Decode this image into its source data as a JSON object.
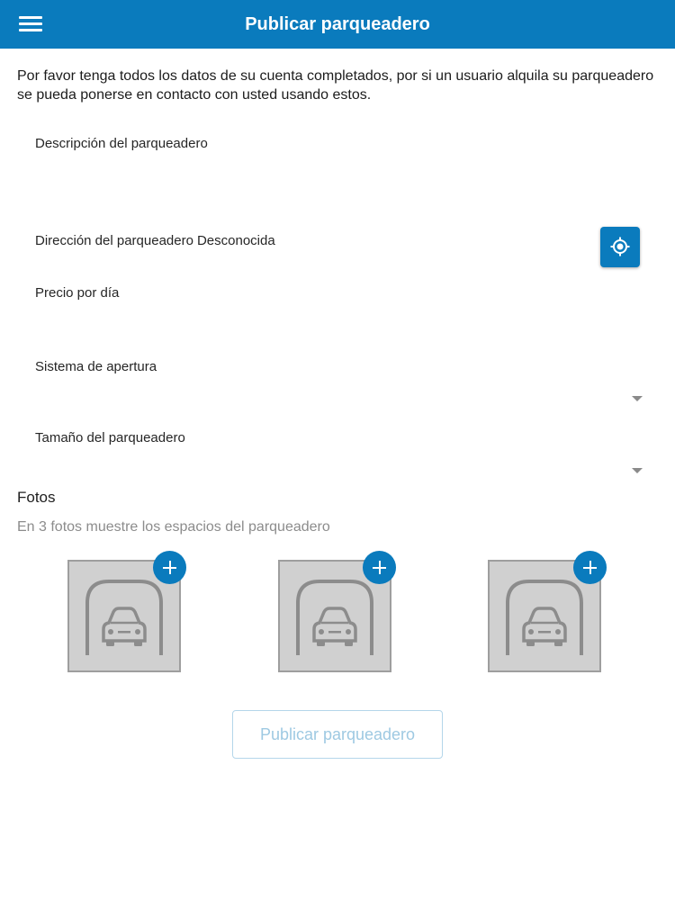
{
  "app_bar": {
    "title": "Publicar parqueadero",
    "menu_icon": "hamburger-menu-icon",
    "color": "#0a7bbd"
  },
  "intro_text": "Por favor tenga todos los datos de su cuenta completados, por si un usuario alquila su parqueadero se pueda ponerse en contacto con usted usando estos.",
  "form": {
    "description_label": "Descripción del parqueadero",
    "address_label": "Dirección del parqueadero",
    "address_value": "Desconocida",
    "locate_icon": "gps-target-icon",
    "price_label": "Precio por día",
    "opening_system_label": "Sistema de apertura",
    "size_label": "Tamaño del parqueadero"
  },
  "photos": {
    "title": "Fotos",
    "hint": "En 3 fotos muestre los espacios del parqueadero",
    "slots": [
      {
        "placeholder_icon": "car-garage-icon",
        "add_icon": "plus-icon"
      },
      {
        "placeholder_icon": "car-garage-icon",
        "add_icon": "plus-icon"
      },
      {
        "placeholder_icon": "car-garage-icon",
        "add_icon": "plus-icon"
      }
    ]
  },
  "publish_button": {
    "label": "Publicar parqueadero",
    "enabled": false
  }
}
